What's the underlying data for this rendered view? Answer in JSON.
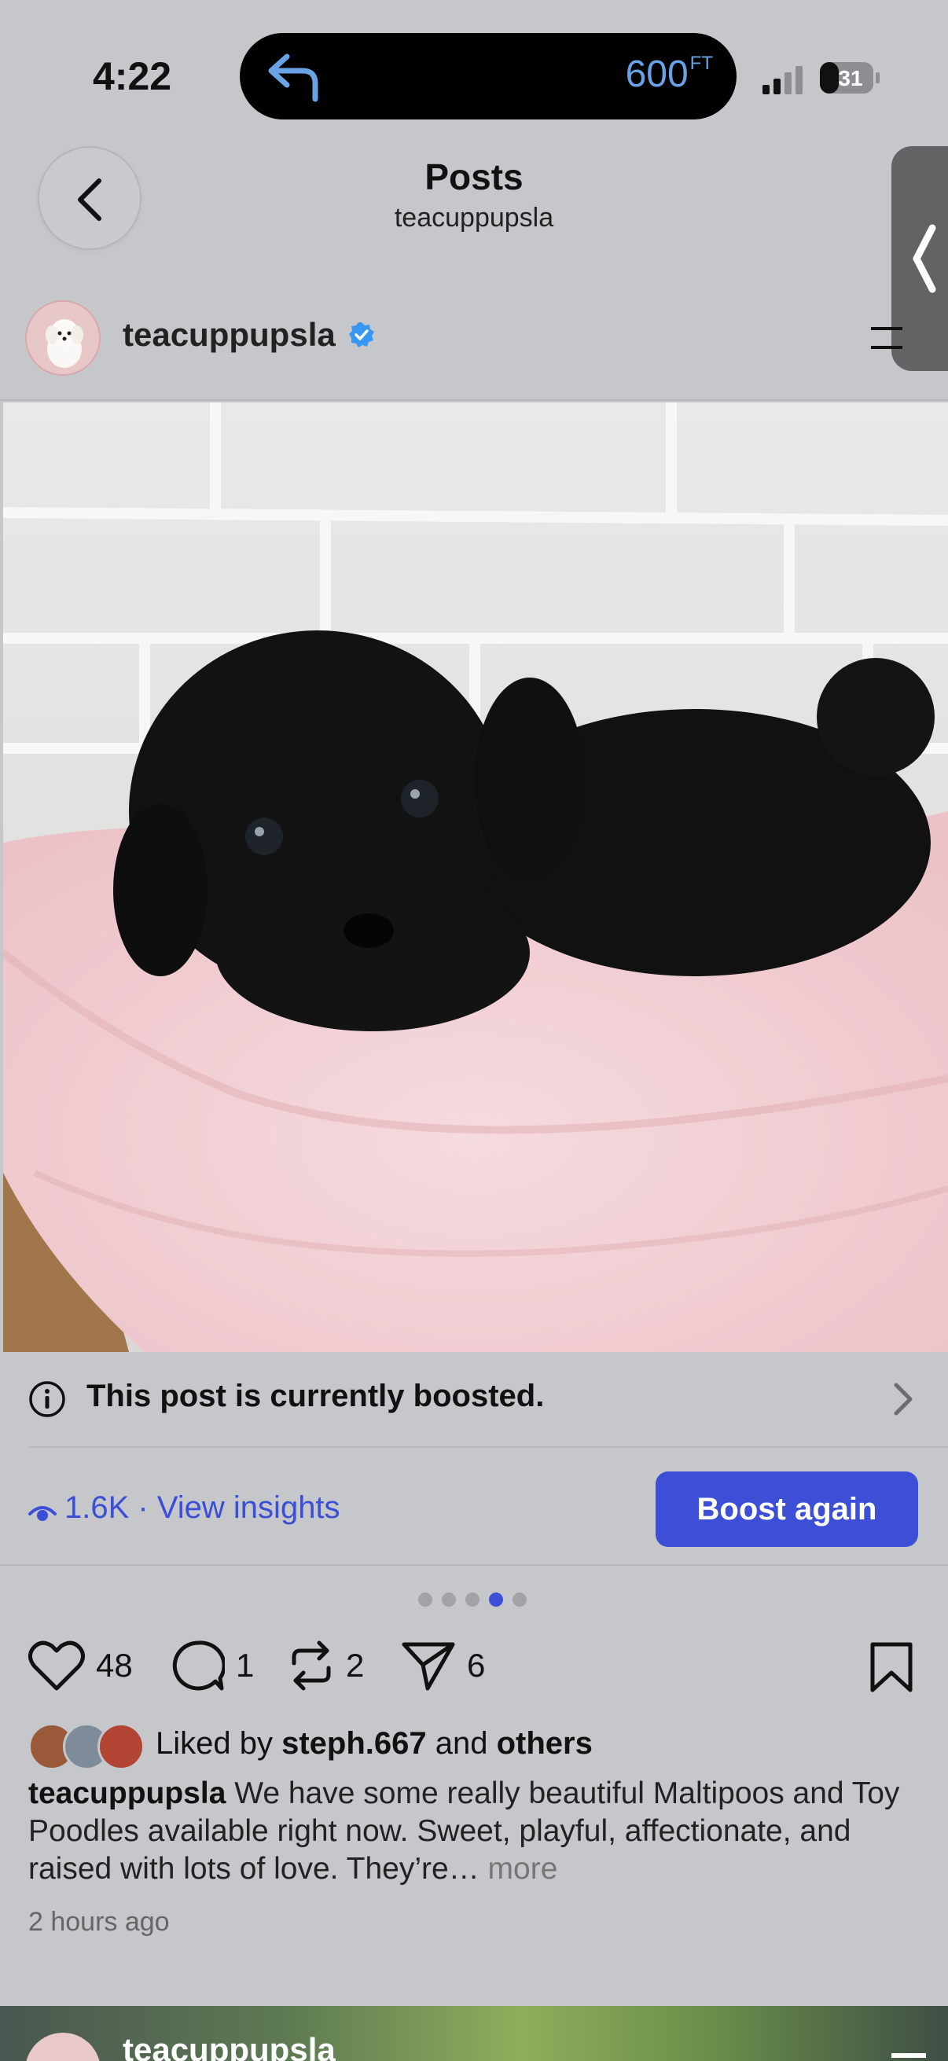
{
  "status_bar": {
    "time": "4:22",
    "nav_distance": "600",
    "nav_unit": "FT",
    "battery": "31"
  },
  "header": {
    "title": "Posts",
    "subtitle": "teacuppupsla"
  },
  "post": {
    "username": "teacuppupsla",
    "verified": true,
    "boost_notice": "This post is currently boosted.",
    "insights_label": "1.6K · View insights",
    "boost_again_label": "Boost again",
    "carousel": {
      "count": 5,
      "active_index": 3
    },
    "actions": {
      "likes": "48",
      "comments": "1",
      "reposts": "2",
      "shares": "6"
    },
    "liked_by": {
      "prefix": "Liked by ",
      "user": "steph.667",
      "middle": " and ",
      "suffix": "others"
    },
    "caption": {
      "username": "teacuppupsla",
      "text": " We have some really beautiful Maltipoos and Toy Poodles available right now. Sweet, playful, affectionate, and raised with lots of love. They’re…",
      "more": " more"
    },
    "time_ago": "2 hours ago"
  },
  "next_post": {
    "username": "teacuppupsla"
  },
  "colors": {
    "background": "#c6c7cb",
    "accent": "#3d4fd6",
    "verified": "#3897f0"
  }
}
